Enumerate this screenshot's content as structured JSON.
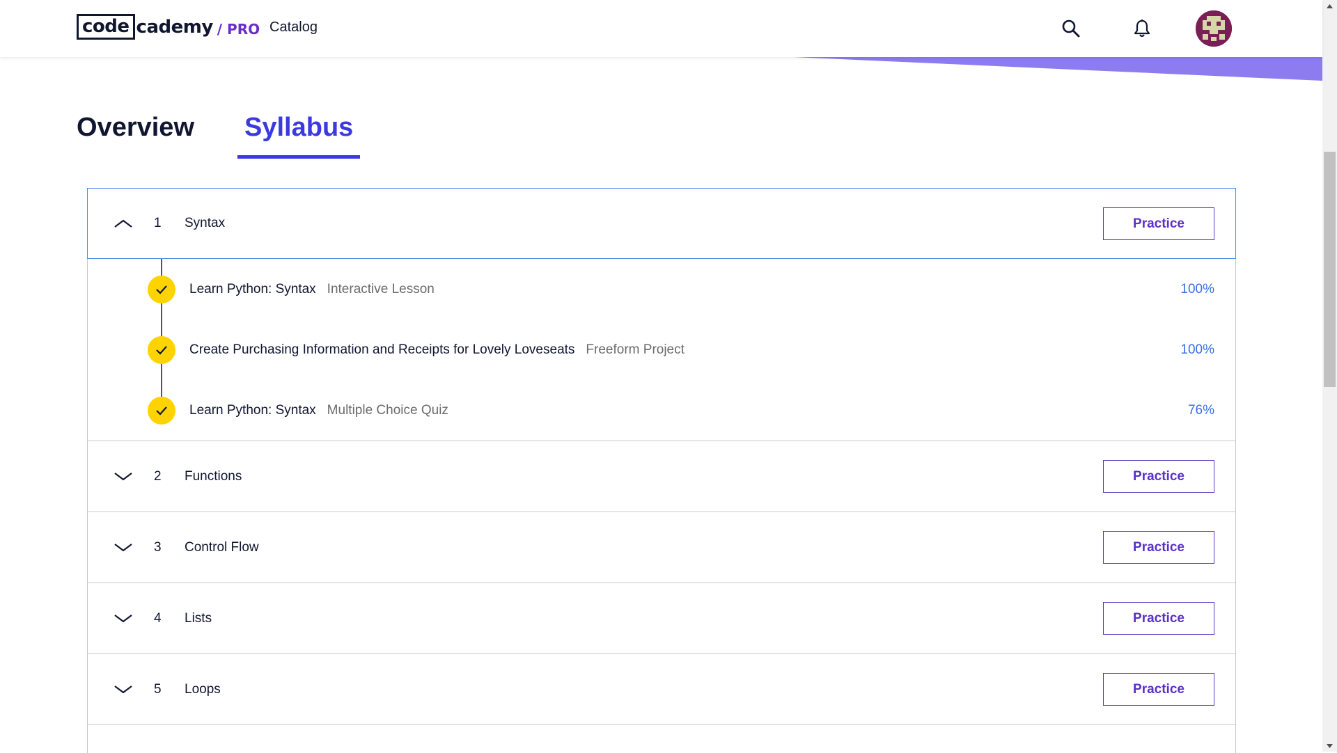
{
  "header": {
    "logo_code": "code",
    "logo_cademy": "cademy",
    "logo_pro": "/ PRO",
    "nav_catalog": "Catalog"
  },
  "tabs": [
    {
      "label": "Overview",
      "active": false
    },
    {
      "label": "Syllabus",
      "active": true
    }
  ],
  "modules": [
    {
      "number": "1",
      "title": "Syntax",
      "practice_label": "Practice",
      "expanded": true,
      "lessons": [
        {
          "title": "Learn Python: Syntax",
          "type": "Interactive Lesson",
          "progress": "100%"
        },
        {
          "title": "Create Purchasing Information and Receipts for Lovely Loveseats",
          "type": "Freeform Project",
          "progress": "100%"
        },
        {
          "title": "Learn Python: Syntax",
          "type": "Multiple Choice Quiz",
          "progress": "76%"
        }
      ]
    },
    {
      "number": "2",
      "title": "Functions",
      "practice_label": "Practice",
      "expanded": false
    },
    {
      "number": "3",
      "title": "Control Flow",
      "practice_label": "Practice",
      "expanded": false
    },
    {
      "number": "4",
      "title": "Lists",
      "practice_label": "Practice",
      "expanded": false
    },
    {
      "number": "5",
      "title": "Loops",
      "practice_label": "Practice",
      "expanded": false
    }
  ],
  "colors": {
    "accent": "#3a3ae0",
    "practice": "#5a30c8",
    "check": "#ffd300",
    "progress": "#3a6fe0",
    "swoosh": "#8c7cf0"
  },
  "icons": [
    "search-icon",
    "bell-icon",
    "avatar",
    "chevron-up-icon",
    "chevron-down-icon",
    "check-icon"
  ]
}
